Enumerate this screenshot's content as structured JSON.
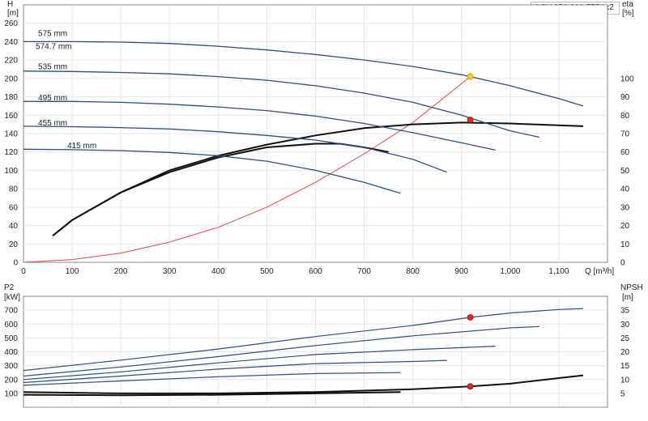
{
  "model": "LSV 250-200-575Ax2",
  "colors": {
    "curve": "#2a4f86",
    "system": "#ee4444",
    "efficiency": "#111111",
    "dot_red": "#e8261e",
    "dot_yellow": "#f6d20a",
    "grid": "#e6e6e6"
  },
  "chart_data": [
    {
      "type": "line",
      "name": "head",
      "ylabel_left": [
        "H",
        "[m]"
      ],
      "ylabel_right": [
        "eta",
        "[%]"
      ],
      "xlabel": "Q [m³/h]",
      "xlim": [
        0,
        1200
      ],
      "ylim_left": [
        0,
        280
      ],
      "ylim_right": [
        0,
        140
      ],
      "xticks": [
        0,
        100,
        200,
        300,
        400,
        500,
        600,
        700,
        800,
        900,
        1000,
        1100
      ],
      "xtick_labels": [
        "0",
        "100",
        "200",
        "300",
        "400",
        "500",
        "600",
        "700",
        "800",
        "900",
        "1,000",
        "1,100"
      ],
      "yticks_left": [
        0,
        20,
        40,
        60,
        80,
        100,
        120,
        140,
        160,
        180,
        200,
        220,
        240,
        260
      ],
      "yticks_right": [
        0,
        10,
        20,
        30,
        40,
        50,
        60,
        70,
        80,
        90,
        100
      ],
      "grid": true,
      "curve_labels": [
        {
          "text": "575 mm",
          "q": 30,
          "h": 246
        },
        {
          "text": "574.7 mm",
          "q": 25,
          "h": 232
        },
        {
          "text": "535 mm",
          "q": 30,
          "h": 210
        },
        {
          "text": "495 mm",
          "q": 30,
          "h": 176
        },
        {
          "text": "455 mm",
          "q": 30,
          "h": 149
        },
        {
          "text": "415 mm",
          "q": 90,
          "h": 124
        }
      ],
      "series": [
        {
          "label": "575 mm",
          "x": [
            0,
            100,
            200,
            300,
            400,
            500,
            600,
            700,
            800,
            900,
            1000,
            1100,
            1150
          ],
          "y": [
            240,
            240,
            239.5,
            238,
            235,
            231,
            226,
            220,
            213,
            204,
            192,
            178,
            170
          ]
        },
        {
          "label": "535 mm",
          "x": [
            0,
            100,
            200,
            300,
            400,
            500,
            600,
            700,
            800,
            900,
            1000,
            1060
          ],
          "y": [
            208,
            207.5,
            206.5,
            205,
            202,
            198,
            192,
            184,
            174,
            160,
            143,
            136
          ]
        },
        {
          "label": "495 mm",
          "x": [
            0,
            100,
            200,
            300,
            400,
            500,
            600,
            700,
            800,
            900,
            970
          ],
          "y": [
            175,
            175,
            174,
            172,
            169,
            165,
            159,
            151,
            141,
            130,
            122
          ]
        },
        {
          "label": "455 mm",
          "x": [
            0,
            100,
            200,
            300,
            400,
            500,
            600,
            700,
            800,
            870
          ],
          "y": [
            148,
            147.5,
            146.5,
            145,
            142,
            138,
            133,
            125,
            112,
            98
          ]
        },
        {
          "label": "415 mm",
          "x": [
            0,
            100,
            200,
            300,
            400,
            500,
            600,
            700,
            775
          ],
          "y": [
            123,
            122.5,
            121.5,
            119.5,
            116,
            110,
            100,
            87,
            75
          ]
        }
      ],
      "efficiency_curves": [
        {
          "x": [
            60,
            100,
            200,
            300,
            400,
            500,
            600,
            650,
            700,
            750
          ],
          "y": [
            14.5,
            23,
            38,
            49,
            57,
            62.5,
            64.5,
            64.5,
            62.5,
            60
          ]
        },
        {
          "x": [
            60,
            100,
            200,
            300,
            400,
            500,
            600,
            700,
            800,
            900,
            1000,
            1150
          ],
          "y": [
            14.5,
            23,
            38,
            50,
            58,
            64,
            69,
            73,
            75,
            76,
            75.5,
            74
          ]
        }
      ],
      "system_curve": {
        "x": [
          0,
          100,
          200,
          300,
          400,
          500,
          600,
          700,
          800,
          918
        ],
        "y": [
          0,
          3,
          10,
          22,
          38,
          60,
          87,
          118,
          152,
          202
        ]
      },
      "operating_points": [
        {
          "q": 918,
          "h": 202,
          "marker": "yellow",
          "axis": "left"
        },
        {
          "q": 918,
          "eta": 77.5,
          "marker": "red",
          "axis": "right"
        }
      ]
    },
    {
      "type": "line",
      "name": "power-npsh",
      "ylabel_left": [
        "P2",
        "[kW]"
      ],
      "ylabel_right": [
        "NPSH",
        "[m]"
      ],
      "xlim": [
        0,
        1200
      ],
      "ylim_left": [
        0,
        800
      ],
      "ylim_right": [
        0,
        40
      ],
      "yticks_left": [
        100,
        200,
        300,
        400,
        500,
        600,
        700
      ],
      "yticks_right": [
        5,
        10,
        15,
        20,
        25,
        30,
        35
      ],
      "grid": true,
      "series": [
        {
          "label": "575 mm",
          "x": [
            0,
            200,
            400,
            600,
            800,
            918,
            1000,
            1100,
            1150
          ],
          "y": [
            265,
            340,
            420,
            510,
            590,
            648,
            680,
            705,
            712
          ]
        },
        {
          "label": "535 mm",
          "x": [
            0,
            200,
            400,
            600,
            800,
            1000,
            1060
          ],
          "y": [
            225,
            290,
            365,
            445,
            515,
            572,
            582
          ]
        },
        {
          "label": "495 mm",
          "x": [
            0,
            200,
            400,
            600,
            800,
            970
          ],
          "y": [
            200,
            255,
            320,
            380,
            415,
            440
          ]
        },
        {
          "label": "455 mm",
          "x": [
            0,
            200,
            400,
            600,
            800,
            870
          ],
          "y": [
            178,
            225,
            275,
            315,
            330,
            338
          ]
        },
        {
          "label": "415 mm",
          "x": [
            0,
            200,
            400,
            600,
            775
          ],
          "y": [
            158,
            190,
            220,
            243,
            250
          ]
        }
      ],
      "npsh_curves": [
        {
          "x": [
            0,
            200,
            400,
            600,
            800,
            918,
            1000,
            1100,
            1150
          ],
          "y": [
            5.5,
            5,
            5,
            5.5,
            6.5,
            7.5,
            8.5,
            10.5,
            11.5
          ]
        },
        {
          "x": [
            0,
            200,
            400,
            600,
            775
          ],
          "y": [
            4.5,
            4.3,
            4.5,
            5,
            5.5
          ]
        }
      ],
      "operating_points": [
        {
          "q": 918,
          "p2": 648,
          "marker": "red",
          "axis": "left"
        },
        {
          "q": 918,
          "npsh": 7.5,
          "marker": "red",
          "axis": "right"
        }
      ]
    }
  ]
}
